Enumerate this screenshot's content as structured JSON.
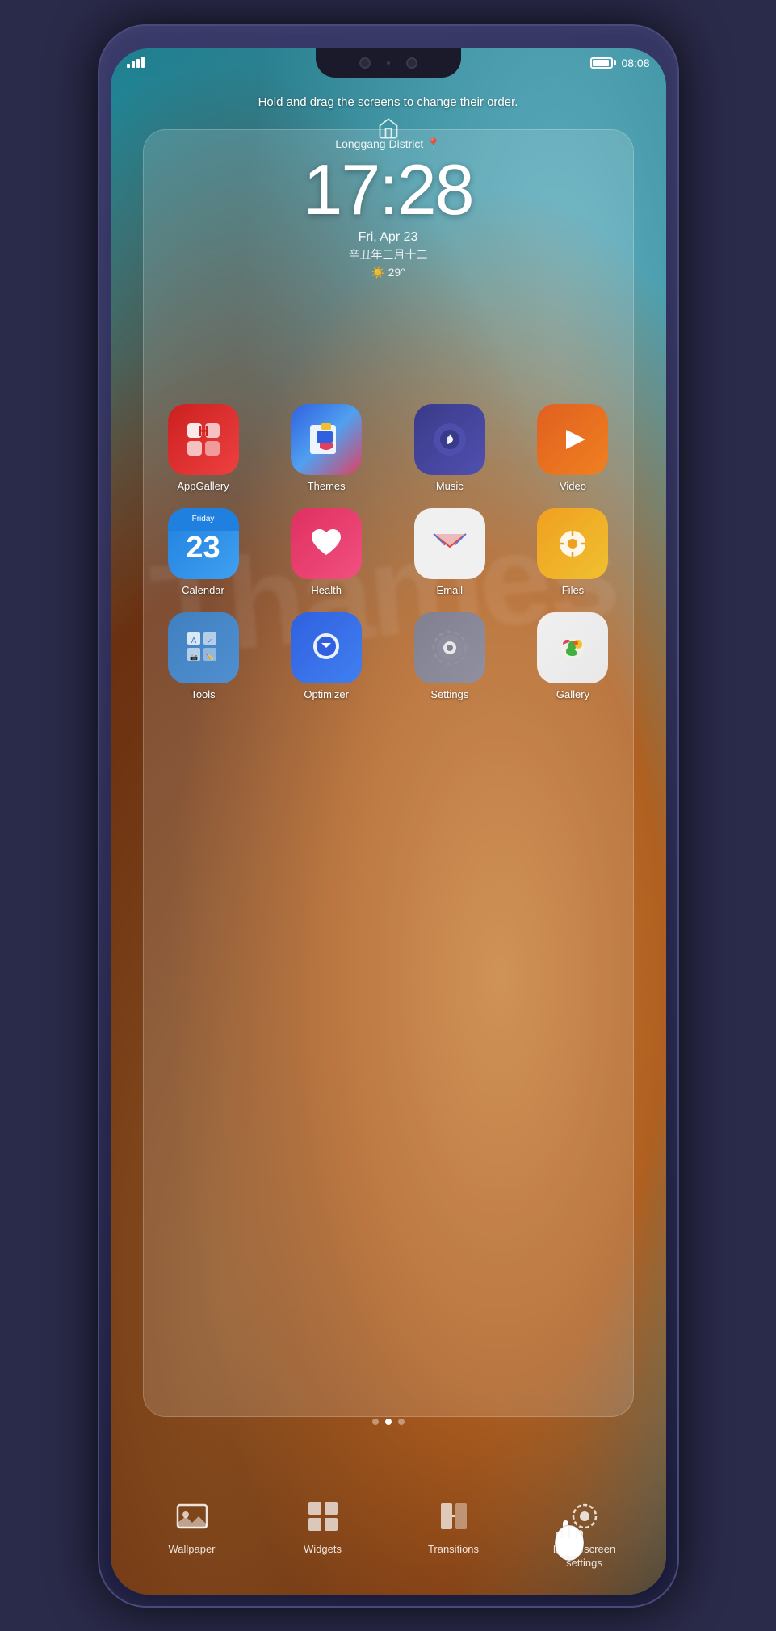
{
  "phone": {
    "status_bar": {
      "time": "08:08",
      "signal_bars": 4,
      "battery_percent": 90
    },
    "instruction": "Hold and drag the screens to change their order.",
    "clock": {
      "location": "Longgang District",
      "time": "17:28",
      "date": "Fri, Apr 23",
      "lunar": "辛丑年三月十二",
      "weather": "29°"
    },
    "apps": {
      "row1": [
        {
          "id": "appgallery",
          "label": "AppGallery",
          "icon": "appgallery"
        },
        {
          "id": "themes",
          "label": "Themes",
          "icon": "themes"
        },
        {
          "id": "music",
          "label": "Music",
          "icon": "music"
        },
        {
          "id": "video",
          "label": "Video",
          "icon": "video"
        }
      ],
      "row2": [
        {
          "id": "calendar",
          "label": "Calendar",
          "icon": "calendar"
        },
        {
          "id": "health",
          "label": "Health",
          "icon": "health"
        },
        {
          "id": "email",
          "label": "Email",
          "icon": "email"
        },
        {
          "id": "files",
          "label": "Files",
          "icon": "files"
        }
      ],
      "row3": [
        {
          "id": "tools",
          "label": "Tools",
          "icon": "tools"
        },
        {
          "id": "optimizer",
          "label": "Optimizer",
          "icon": "optimizer"
        },
        {
          "id": "settings",
          "label": "Settings",
          "icon": "settings"
        },
        {
          "id": "gallery",
          "label": "Gallery",
          "icon": "gallery"
        }
      ]
    },
    "page_dots": [
      {
        "active": false
      },
      {
        "active": true
      },
      {
        "active": false
      }
    ],
    "toolbar": {
      "items": [
        {
          "id": "wallpaper",
          "label": "Wallpaper"
        },
        {
          "id": "widgets",
          "label": "Widgets"
        },
        {
          "id": "transitions",
          "label": "Transitions"
        },
        {
          "id": "homescreen-settings",
          "label": "Home screen\nsettings"
        }
      ]
    },
    "thames_label": "Thames"
  }
}
